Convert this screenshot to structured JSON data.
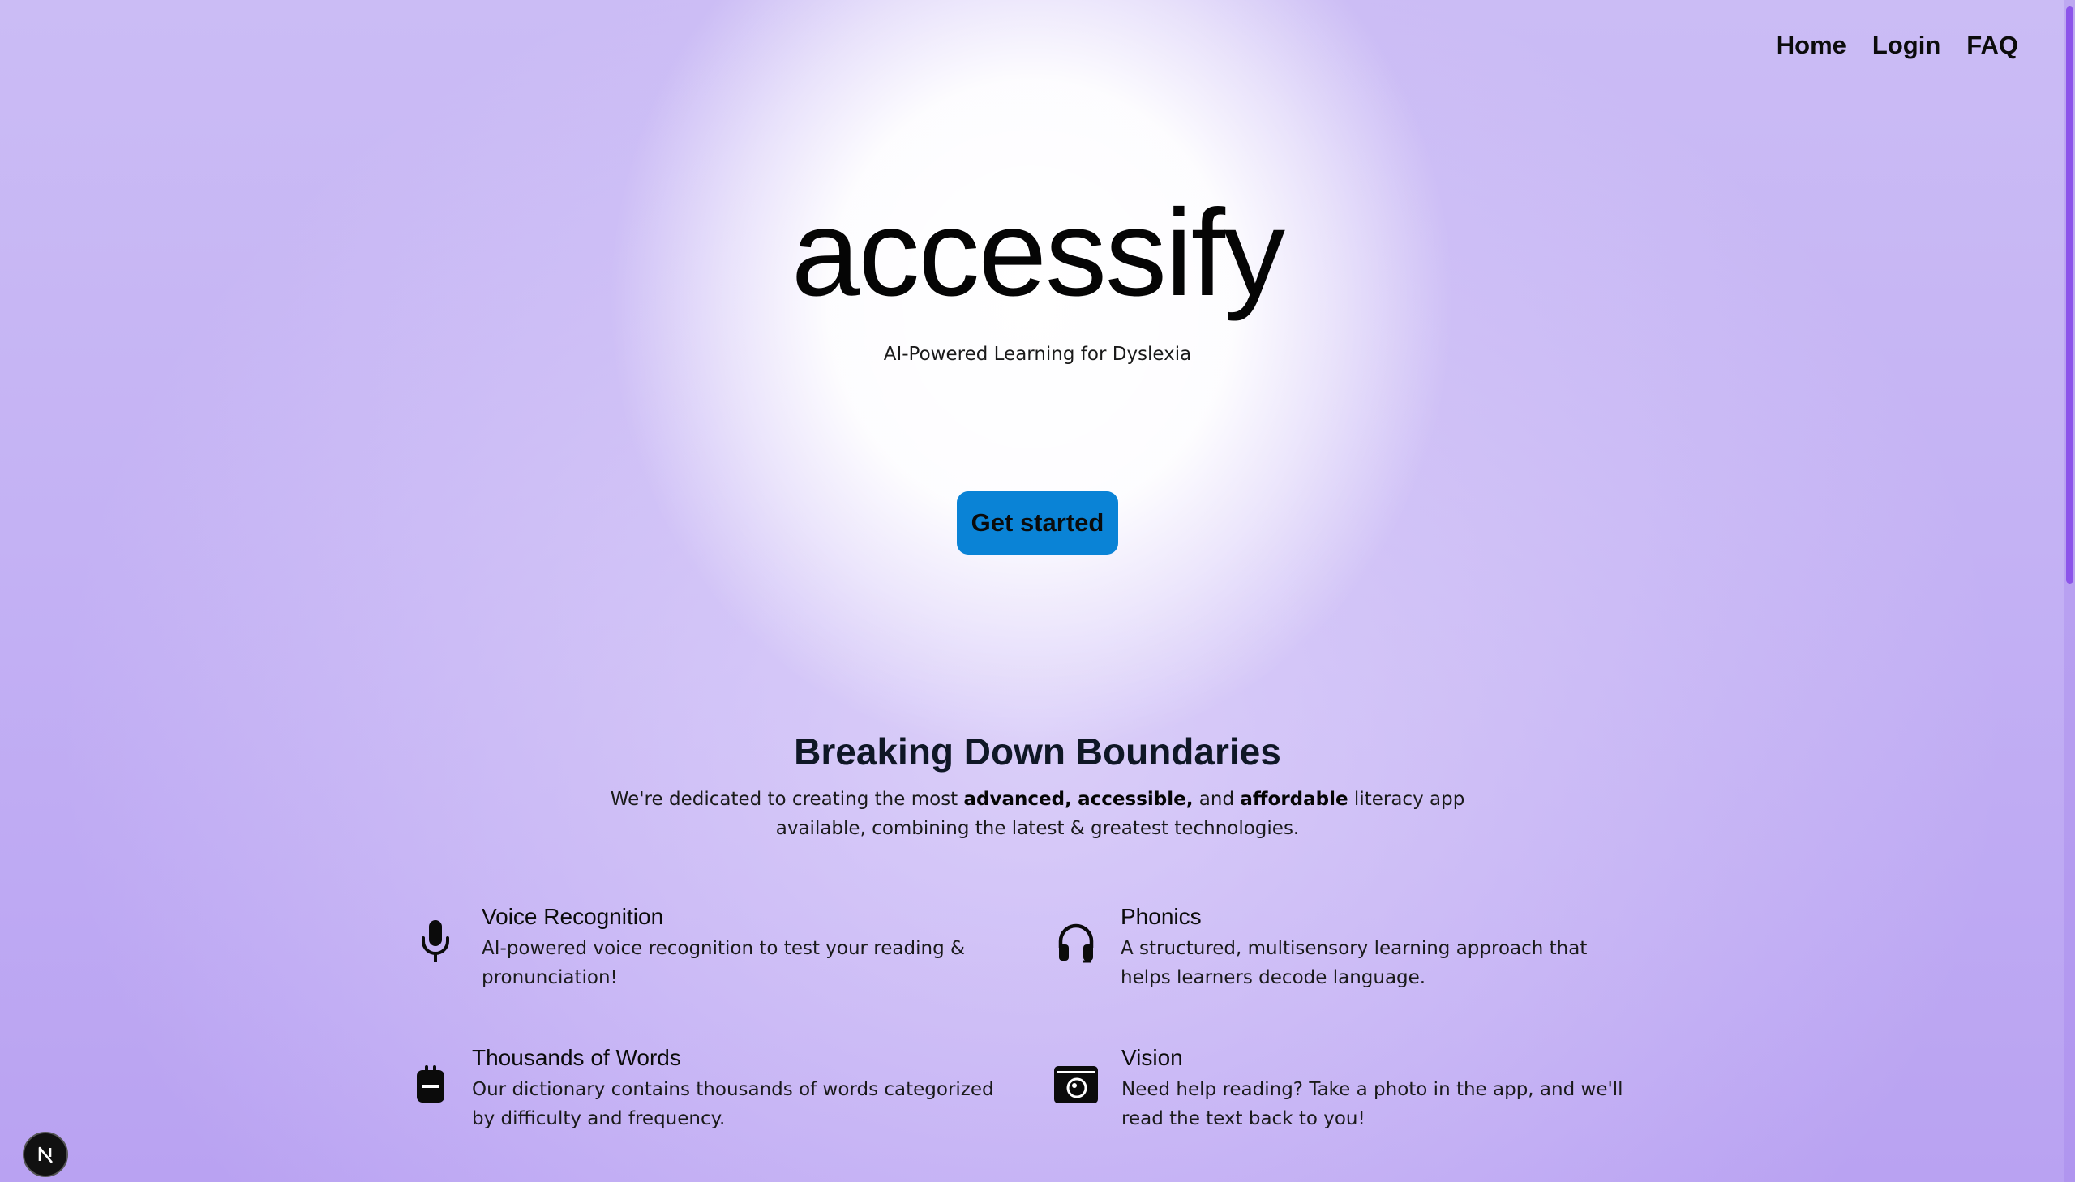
{
  "nav": {
    "items": [
      {
        "label": "Home"
      },
      {
        "label": "Login"
      },
      {
        "label": "FAQ"
      }
    ]
  },
  "hero": {
    "logo": "accessify",
    "tagline": "AI-Powered Learning for Dyslexia",
    "cta": "Get started"
  },
  "section": {
    "title": "Breaking Down Boundaries",
    "desc_before": "We're dedicated to creating the most ",
    "desc_bold_1": "advanced,",
    "desc_space_1": " ",
    "desc_bold_2": "accessible,",
    "desc_mid": " and ",
    "desc_bold_3": "affordable",
    "desc_line1_end": " literacy app",
    "desc_line2": "available, combining the latest & greatest technologies."
  },
  "features": [
    {
      "icon": "microphone-icon",
      "title": "Voice Recognition",
      "desc": "AI-powered voice recognition to test your reading & pronunciation!"
    },
    {
      "icon": "headphones-icon",
      "title": "Phonics",
      "desc": "A structured, multisensory learning approach that helps learners decode language."
    },
    {
      "icon": "backpack-icon",
      "title": "Thousands of Words",
      "desc": "Our dictionary contains thousands of words categorized by difficulty and frequency."
    },
    {
      "icon": "camera-icon",
      "title": "Vision",
      "desc": "Need help reading? Take a photo in the app, and we'll read the text back to you!"
    }
  ],
  "colors": {
    "accent": "#0a83d6",
    "scroll_thumb": "#8c54ea"
  },
  "badge": {
    "icon": "nextjs-icon"
  }
}
